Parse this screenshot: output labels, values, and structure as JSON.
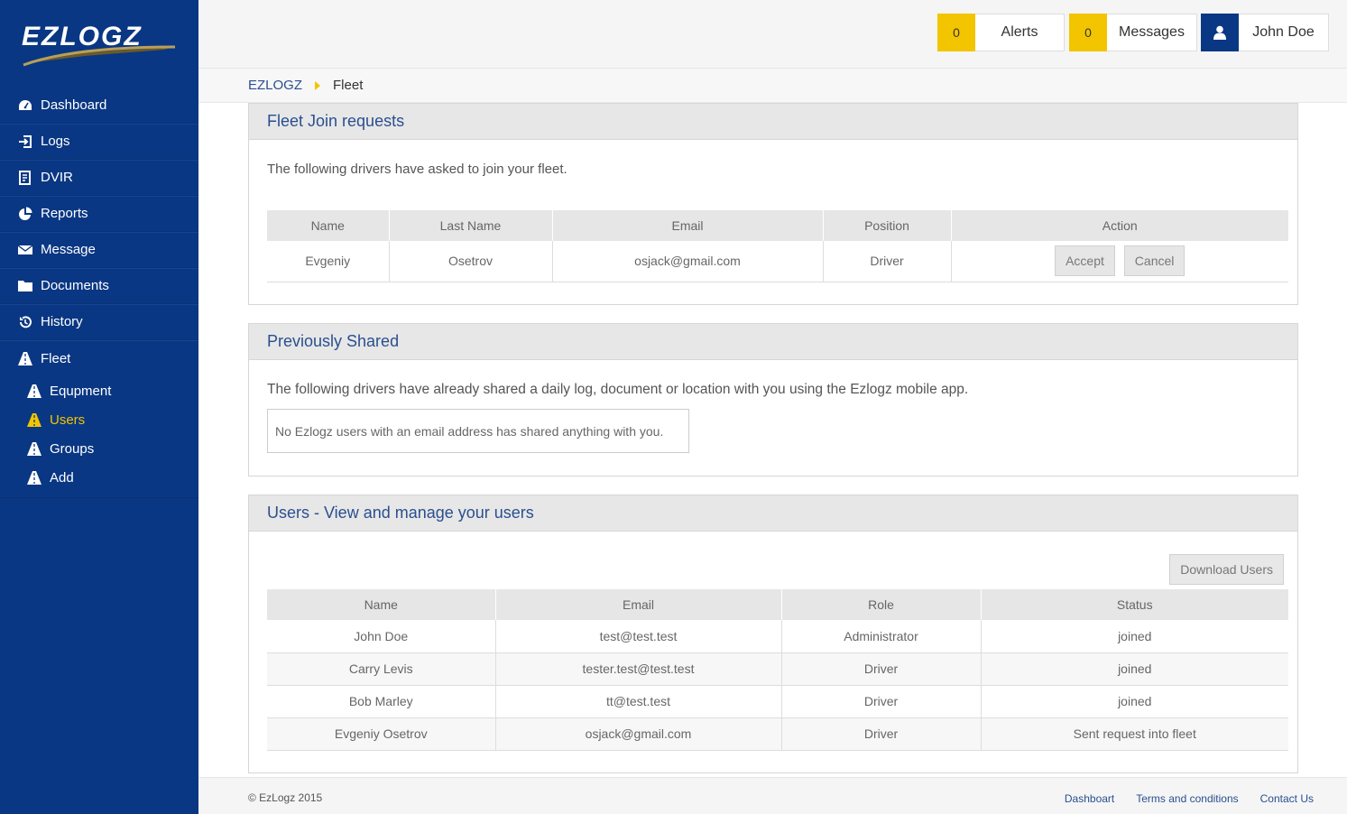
{
  "brand": {
    "logo_text": "EZLOGZ"
  },
  "sidebar": {
    "items": [
      {
        "label": "Dashboard",
        "icon": "dashboard-icon"
      },
      {
        "label": "Logs",
        "icon": "sign-in-icon"
      },
      {
        "label": "DVIR",
        "icon": "dvir-icon"
      },
      {
        "label": "Reports",
        "icon": "pie-chart-icon"
      },
      {
        "label": "Message",
        "icon": "envelope-icon"
      },
      {
        "label": "Documents",
        "icon": "folder-icon"
      },
      {
        "label": "History",
        "icon": "history-icon"
      },
      {
        "label": "Fleet",
        "icon": "road-icon"
      }
    ],
    "fleet_sub": [
      {
        "label": "Equpment",
        "icon": "road-icon"
      },
      {
        "label": "Users",
        "icon": "road-icon",
        "active": true
      },
      {
        "label": "Groups",
        "icon": "road-icon"
      },
      {
        "label": "Add",
        "icon": "road-icon"
      }
    ]
  },
  "header": {
    "alerts_count": "0",
    "alerts_label": "Alerts",
    "messages_count": "0",
    "messages_label": "Messages",
    "user_name": "John Doe"
  },
  "breadcrumb": {
    "root": "EZLOGZ",
    "current": "Fleet"
  },
  "join_requests": {
    "title": "Fleet Join requests",
    "description": "The following drivers have asked to join your fleet.",
    "columns": [
      "Name",
      "Last Name",
      "Email",
      "Position",
      "Action"
    ],
    "rows": [
      {
        "name": "Evgeniy",
        "last_name": "Osetrov",
        "email": "osjack@gmail.com",
        "position": "Driver"
      }
    ],
    "accept_label": "Accept",
    "cancel_label": "Cancel"
  },
  "previously_shared": {
    "title": "Previously Shared",
    "description": "The following drivers have already shared a daily log, document or location with you using the Ezlogz mobile app.",
    "empty_message": "No Ezlogz users with an email address has shared anything with you."
  },
  "users": {
    "title": "Users - View and manage your users",
    "download_label": "Download Users",
    "columns": [
      "Name",
      "Email",
      "Role",
      "Status"
    ],
    "rows": [
      {
        "name": "John Doe",
        "email": "test@test.test",
        "role": "Administrator",
        "status": "joined"
      },
      {
        "name": "Carry Levis",
        "email": "tester.test@test.test",
        "role": "Driver",
        "status": "joined"
      },
      {
        "name": "Bob Marley",
        "email": "tt@test.test",
        "role": "Driver",
        "status": "joined"
      },
      {
        "name": "Evgeniy Osetrov",
        "email": "osjack@gmail.com",
        "role": "Driver",
        "status": "Sent request into fleet"
      }
    ]
  },
  "footer": {
    "copyright": "© EzLogz 2015",
    "links": [
      "Dashboart",
      "Terms and conditions",
      "Contact Us"
    ]
  },
  "colors": {
    "sidebar": "#0a3783",
    "accent": "#f2c500",
    "title": "#2a4f8f"
  }
}
